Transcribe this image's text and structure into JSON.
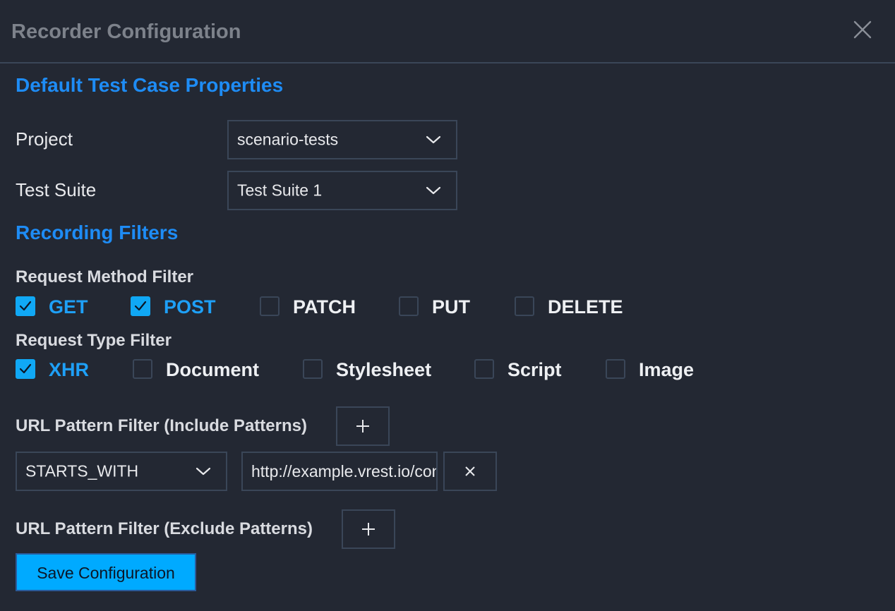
{
  "dialog": {
    "title": "Recorder Configuration"
  },
  "default_props": {
    "section_title": "Default Test Case Properties",
    "project_label": "Project",
    "project_value": "scenario-tests",
    "suite_label": "Test Suite",
    "suite_value": "Test Suite 1"
  },
  "filters": {
    "section_title": "Recording Filters",
    "method_label": "Request Method Filter",
    "methods": [
      {
        "label": "GET",
        "checked": true
      },
      {
        "label": "POST",
        "checked": true
      },
      {
        "label": "PATCH",
        "checked": false
      },
      {
        "label": "PUT",
        "checked": false
      },
      {
        "label": "DELETE",
        "checked": false
      }
    ],
    "type_label": "Request Type Filter",
    "types": [
      {
        "label": "XHR",
        "checked": true
      },
      {
        "label": "Document",
        "checked": false
      },
      {
        "label": "Stylesheet",
        "checked": false
      },
      {
        "label": "Script",
        "checked": false
      },
      {
        "label": "Image",
        "checked": false
      }
    ],
    "include_label": "URL Pattern Filter (Include Patterns)",
    "include_patterns": [
      {
        "match_type": "STARTS_WITH",
        "value": "http://example.vrest.io/contacts"
      }
    ],
    "exclude_label": "URL Pattern Filter (Exclude Patterns)"
  },
  "actions": {
    "save_label": "Save Configuration"
  },
  "icons": {
    "close": "close-icon",
    "chevron": "chevron-down-icon",
    "plus": "plus-icon",
    "remove": "close-icon",
    "check": "checkmark-icon"
  },
  "colors": {
    "background": "#232833",
    "border": "#3a4658",
    "accent": "#1e8cf5",
    "checkbox_checked": "#10a8f5",
    "button": "#00aaff"
  }
}
